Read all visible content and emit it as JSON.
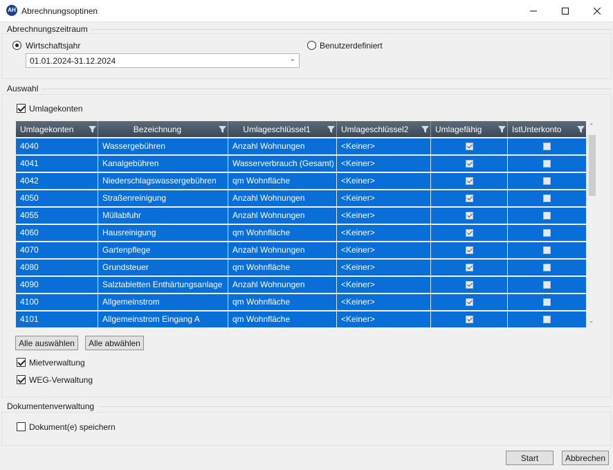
{
  "window": {
    "title": "Abrechnungsoptinen",
    "icon_text": "AH",
    "controls": [
      "minimize-icon",
      "maximize-icon",
      "close-icon"
    ]
  },
  "period": {
    "legend": "Abrechnungszeitraum",
    "option_fiscal": "Wirtschaftsjahr",
    "option_custom": "Benutzerdefiniert",
    "selected": "Wirtschaftsjahr",
    "range_value": "01.01.2024-31.12.2024"
  },
  "selection": {
    "legend": "Auswahl",
    "umlagekonten_label": "Umlagekonten",
    "umlagekonten_checked": true,
    "columns": [
      "Umlagekonten",
      "Bezeichnung",
      "Umlageschlüssel1",
      "Umlageschlüssel2",
      "Umlagefähig",
      "IstUnterkonto"
    ],
    "rows": [
      {
        "konto": "4040",
        "bez": "Wassergebühren",
        "s1": "Anzahl Wohnungen",
        "s2": "<Keiner>",
        "fahig": true,
        "unter": false
      },
      {
        "konto": "4041",
        "bez": "Kanalgebühren",
        "s1": "Wasserverbrauch (Gesamt)",
        "s2": "<Keiner>",
        "fahig": true,
        "unter": false
      },
      {
        "konto": "4042",
        "bez": "Niederschlagswassergebühren",
        "s1": "qm Wohnfläche",
        "s2": "<Keiner>",
        "fahig": true,
        "unter": false
      },
      {
        "konto": "4050",
        "bez": "Straßenreinigung",
        "s1": "Anzahl Wohnungen",
        "s2": "<Keiner>",
        "fahig": true,
        "unter": false
      },
      {
        "konto": "4055",
        "bez": "Müllabfuhr",
        "s1": "Anzahl Wohnungen",
        "s2": "<Keiner>",
        "fahig": true,
        "unter": false
      },
      {
        "konto": "4060",
        "bez": "Hausreinigung",
        "s1": "qm Wohnfläche",
        "s2": "<Keiner>",
        "fahig": true,
        "unter": false
      },
      {
        "konto": "4070",
        "bez": "Gartenpflege",
        "s1": "Anzahl Wohnungen",
        "s2": "<Keiner>",
        "fahig": true,
        "unter": false
      },
      {
        "konto": "4080",
        "bez": "Grundsteuer",
        "s1": "qm Wohnfläche",
        "s2": "<Keiner>",
        "fahig": true,
        "unter": false
      },
      {
        "konto": "4090",
        "bez": "Salztabletten Enthärtungsanlage",
        "s1": "Anzahl Wohnungen",
        "s2": "<Keiner>",
        "fahig": true,
        "unter": false
      },
      {
        "konto": "4100",
        "bez": "Allgemeinstrom",
        "s1": "qm Wohnfläche",
        "s2": "<Keiner>",
        "fahig": true,
        "unter": false
      },
      {
        "konto": "4101",
        "bez": "Allgemeinstrom Eingang A",
        "s1": "qm Wohnfläche",
        "s2": "<Keiner>",
        "fahig": true,
        "unter": false
      }
    ],
    "select_all_label": "Alle auswählen",
    "deselect_all_label": "Alle abwählen",
    "mietverwaltung_label": "Mietverwaltung",
    "mietverwaltung_checked": true,
    "weg_label": "WEG-Verwaltung",
    "weg_checked": true
  },
  "documents": {
    "legend": "Dokumentenverwaltung",
    "save_label": "Dokument(e) speichern",
    "save_checked": false
  },
  "footer": {
    "start_label": "Start",
    "cancel_label": "Abbrechen"
  },
  "colors": {
    "row_selected": "#0a6ed8",
    "header_bg": "#4a5666"
  }
}
